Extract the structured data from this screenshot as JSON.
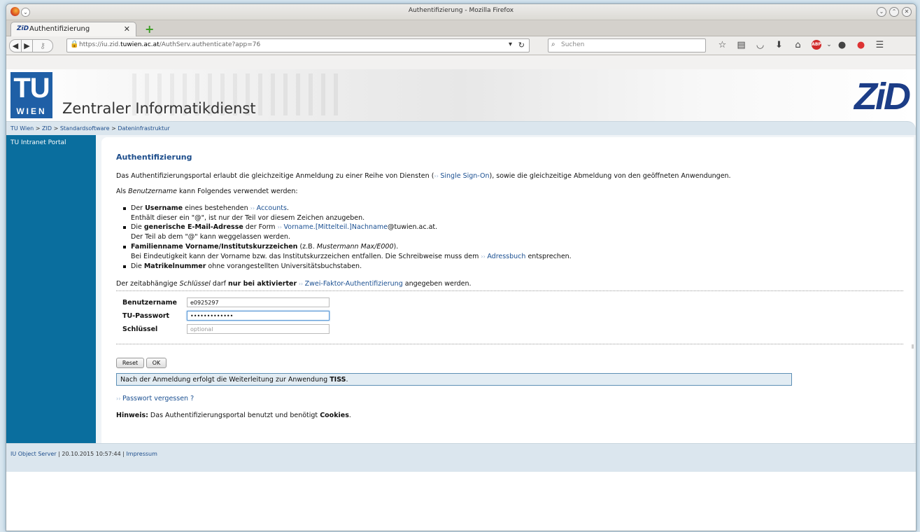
{
  "browser": {
    "window_title": "Authentifizierung - Mozilla Firefox",
    "tab_title": "Authentifizierung",
    "tab_icon_text": "ZiD",
    "url_prefix": "https://iu.zid.",
    "url_domain": "tuwien.ac.at",
    "url_path": "/AuthServ.authenticate?app=76",
    "search_placeholder": "Suchen",
    "colors": {
      "abp": "#d02a2a",
      "newtab": "#3a9d22"
    }
  },
  "header": {
    "tu_logo_top": "TU",
    "tu_logo_bottom": "WIEN",
    "org_name": "Zentraler Informatikdienst",
    "zid_logo": "ZiD",
    "colors": {
      "tu_blue": "#1f5fa6",
      "zid_blue": "#1c3d87"
    }
  },
  "breadcrumb": {
    "items": [
      "TU Wien",
      "ZID",
      "Standardsoftware",
      "Dateninfrastruktur"
    ],
    "separator": ">"
  },
  "sidebar": {
    "items": [
      "TU Intranet Portal"
    ],
    "color": "#0a6e9e"
  },
  "main": {
    "heading": "Authentifizierung",
    "intro_a": "Das Authentifizierungsportal erlaubt die gleichzeitige Anmeldung zu einer Reihe von Diensten (",
    "intro_link": "Single Sign-On",
    "intro_b": "), sowie die gleichzeitige Abmeldung von den geöffneten Anwendungen.",
    "as_a": "Als ",
    "as_em": "Benutzername",
    "as_b": " kann Folgendes verwendet werden:",
    "b1_a": "Der ",
    "b1_bold": "Username",
    "b1_b": " eines bestehenden ",
    "b1_link": "Accounts",
    "b1_c": ".",
    "b1_sub": "Enthält dieser ein \"@\", ist nur der Teil vor diesem Zeichen anzugeben.",
    "b2_a": "Die ",
    "b2_bold": "generische E-Mail-Adresse",
    "b2_b": " der Form ",
    "b2_link": "Vorname.[Mittelteil.]Nachname",
    "b2_c": "@tuwien.ac.at.",
    "b2_sub": "Der Teil ab dem \"@\" kann weggelassen werden.",
    "b3_bold": "Familienname Vorname/Institutskurzzeichen",
    "b3_a": " (z.B. ",
    "b3_em": "Mustermann Max/E000",
    "b3_b": ").",
    "b3_sub_a": "Bei Eindeutigkeit kann der Vorname bzw. das Institutskurzzeichen entfallen. Die Schreibweise muss dem ",
    "b3_sub_link": "Adressbuch",
    "b3_sub_b": " entsprechen.",
    "b4_a": "Die ",
    "b4_bold": "Matrikelnummer",
    "b4_b": " ohne vorangestellten Universitätsbuchstaben.",
    "key_a": "Der zeitabhängige ",
    "key_em": "Schlüssel",
    "key_b": " darf ",
    "key_bold": "nur bei aktivierter",
    "key_link": "Zwei-Faktor-Authentifizierung",
    "key_c": " angegeben werden.",
    "form": {
      "username_label": "Benutzername",
      "username_value": "e0925297",
      "password_label": "TU-Passwort",
      "password_value": "•••••••••••••",
      "key_label": "Schlüssel",
      "key_placeholder": "optional"
    },
    "reset_label": "Reset",
    "ok_label": "OK",
    "notice_a": "Nach der Anmeldung erfolgt die Weiterleitung zur Anwendung ",
    "notice_bold": "TISS",
    "notice_b": ".",
    "forgot_link": "Passwort vergessen ?",
    "hint_bold": "Hinweis:",
    "hint_a": " Das Authentifizierungsportal benutzt und benötigt ",
    "hint_bold2": "Cookies",
    "hint_b": "."
  },
  "footer": {
    "server": "IU Object Server",
    "timestamp": "20.10.2015 10:57:44",
    "impressum": "Impressum"
  }
}
